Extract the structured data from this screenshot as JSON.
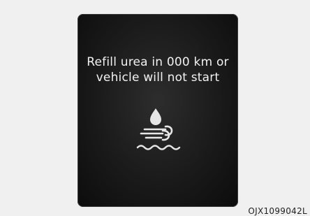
{
  "display": {
    "message_line1": "Refill urea in 000 km or",
    "message_line2": "vehicle will not start",
    "icon": "urea-warning-icon"
  },
  "figure_code": "OJX1099042L",
  "colors": {
    "page_background": "#f0f0f0",
    "panel_background": "#1a1a1a",
    "message_text": "#f2f2f2",
    "icon_stroke": "#e6e6e6"
  }
}
